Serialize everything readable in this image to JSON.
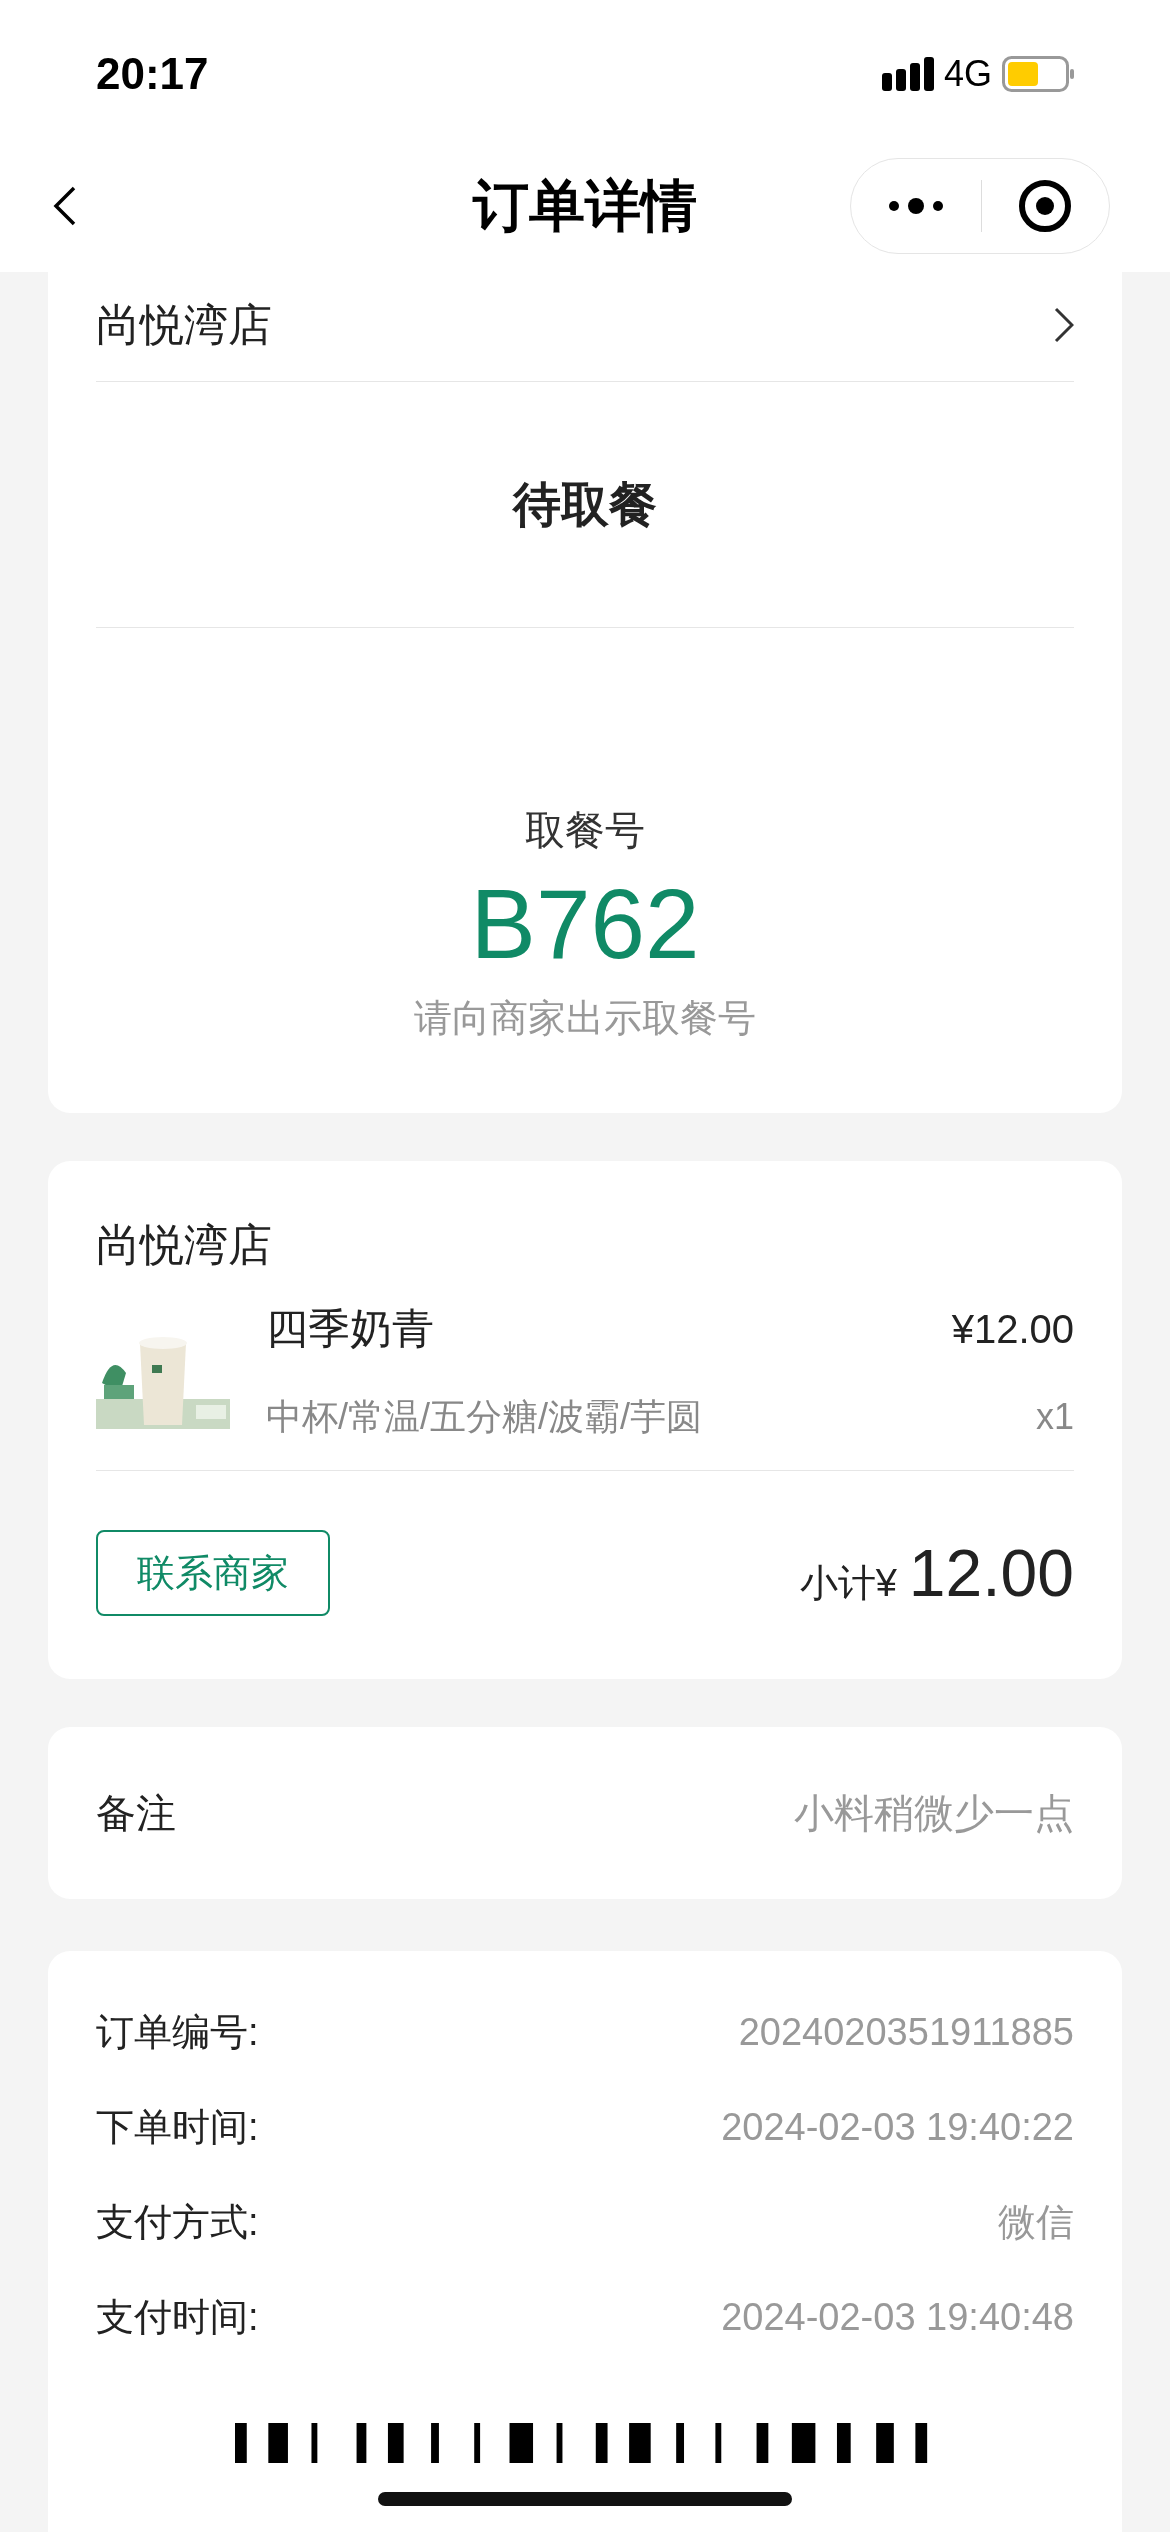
{
  "status_bar": {
    "time": "20:17",
    "network": "4G"
  },
  "nav": {
    "title": "订单详情"
  },
  "pickup_card": {
    "store": "尚悦湾店",
    "status": "待取餐",
    "code_label": "取餐号",
    "code": "B762",
    "hint": "请向商家出示取餐号"
  },
  "order_card": {
    "store": "尚悦湾店",
    "items": [
      {
        "kind": "picture",
        "name": "四季奶青",
        "options": "中杯/常温/五分糖/波霸/芋圆",
        "price": "¥12.00",
        "quantity": "x1"
      }
    ],
    "contact_button": "联系商家",
    "subtotal_label": "小计¥",
    "subtotal": "12.00"
  },
  "remark": {
    "label": "备注",
    "value": "小料稍微少一点"
  },
  "details": [
    {
      "label": "订单编号:",
      "value": "2024020351911885"
    },
    {
      "label": "下单时间:",
      "value": "2024-02-03 19:40:22"
    },
    {
      "label": "支付方式:",
      "value": "微信"
    },
    {
      "label": "支付时间:",
      "value": "2024-02-03 19:40:48"
    }
  ]
}
